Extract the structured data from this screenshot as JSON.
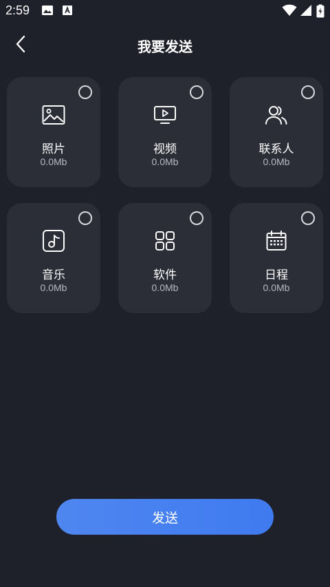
{
  "status_bar": {
    "time": "2:59",
    "icons": [
      "image-icon",
      "font-a-icon",
      "wifi-icon",
      "signal-icon",
      "battery-charging-icon"
    ]
  },
  "header": {
    "back_icon": "chevron-left-icon",
    "title": "我要发送"
  },
  "categories": [
    {
      "label": "照片",
      "size": "0.0Mb",
      "icon": "photo-icon",
      "selected": false
    },
    {
      "label": "视频",
      "size": "0.0Mb",
      "icon": "video-icon",
      "selected": false
    },
    {
      "label": "联系人",
      "size": "0.0Mb",
      "icon": "contacts-icon",
      "selected": false
    },
    {
      "label": "音乐",
      "size": "0.0Mb",
      "icon": "music-icon",
      "selected": false
    },
    {
      "label": "软件",
      "size": "0.0Mb",
      "icon": "apps-icon",
      "selected": false
    },
    {
      "label": "日程",
      "size": "0.0Mb",
      "icon": "calendar-icon",
      "selected": false
    }
  ],
  "send_button": {
    "label": "发送"
  },
  "colors": {
    "background": "#1e212a",
    "card": "#2b2e37",
    "accent": "#4a82f0",
    "muted_text": "#b5b8c0"
  }
}
